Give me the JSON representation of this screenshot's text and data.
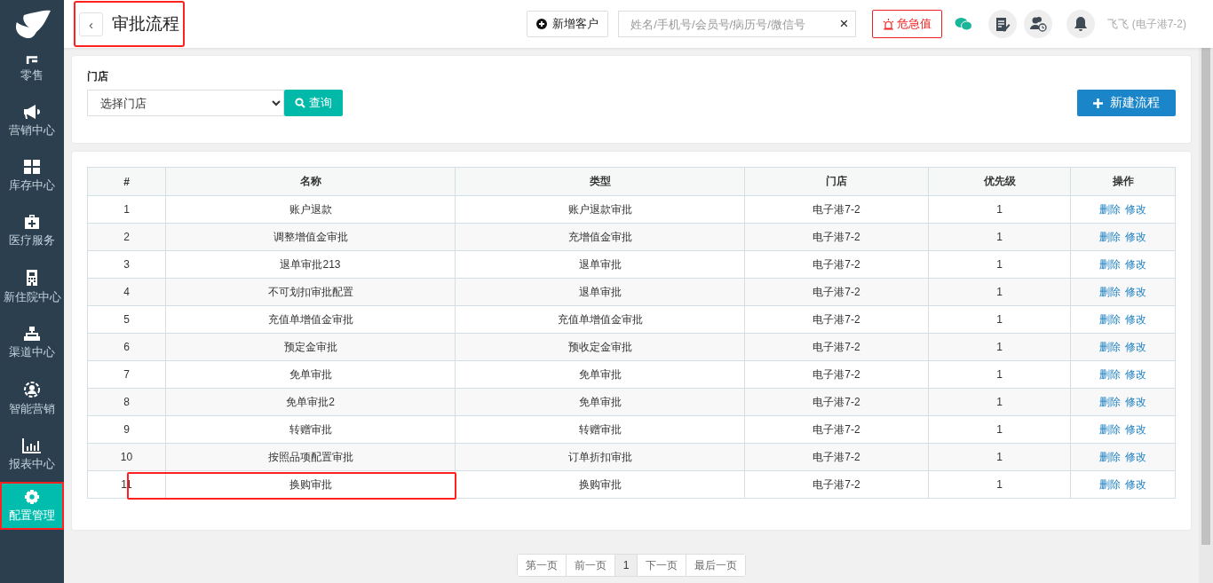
{
  "sidebar": {
    "items": [
      {
        "label": "零售",
        "selected": false,
        "highlighted": false
      },
      {
        "label": "营销中心",
        "selected": false,
        "highlighted": false
      },
      {
        "label": "库存中心",
        "selected": false,
        "highlighted": false
      },
      {
        "label": "医疗服务",
        "selected": false,
        "highlighted": false
      },
      {
        "label": "新住院中心",
        "selected": false,
        "highlighted": false
      },
      {
        "label": "渠道中心",
        "selected": false,
        "highlighted": false
      },
      {
        "label": "智能营销",
        "selected": false,
        "highlighted": false
      },
      {
        "label": "报表中心",
        "selected": false,
        "highlighted": false
      },
      {
        "label": "配置管理",
        "selected": true,
        "highlighted": true
      }
    ]
  },
  "header": {
    "back": "‹",
    "title": "审批流程",
    "highlighted": true,
    "add_customer": "新增客户",
    "search": {
      "placeholder": "姓名/手机号/会员号/病历号/微信号"
    },
    "clear": "×",
    "alert": "危急值",
    "user": "飞飞 (电子港7-2)"
  },
  "filter": {
    "label": "门店",
    "store_select": "选择门店",
    "query": "查询",
    "new_flow": "新建流程"
  },
  "table": {
    "columns": [
      "#",
      "名称",
      "类型",
      "门店",
      "优先级",
      "操作"
    ],
    "rows": [
      {
        "cells": [
          "1",
          "账户退款",
          "账户退款审批",
          "电子港7-2",
          "1"
        ],
        "actions": [
          "删除",
          "修改"
        ],
        "highlighted": false
      },
      {
        "cells": [
          "2",
          "调整增值金审批",
          "充增值金审批",
          "电子港7-2",
          "1"
        ],
        "actions": [
          "删除",
          "修改"
        ],
        "highlighted": false
      },
      {
        "cells": [
          "3",
          "退单审批213",
          "退单审批",
          "电子港7-2",
          "1"
        ],
        "actions": [
          "删除",
          "修改"
        ],
        "highlighted": false
      },
      {
        "cells": [
          "4",
          "不可划扣审批配置",
          "退单审批",
          "电子港7-2",
          "1"
        ],
        "actions": [
          "删除",
          "修改"
        ],
        "highlighted": false
      },
      {
        "cells": [
          "5",
          "充值单增值金审批",
          "充值单增值金审批",
          "电子港7-2",
          "1"
        ],
        "actions": [
          "删除",
          "修改"
        ],
        "highlighted": false
      },
      {
        "cells": [
          "6",
          "预定金审批",
          "预收定金审批",
          "电子港7-2",
          "1"
        ],
        "actions": [
          "删除",
          "修改"
        ],
        "highlighted": false
      },
      {
        "cells": [
          "7",
          "免单审批",
          "免单审批",
          "电子港7-2",
          "1"
        ],
        "actions": [
          "删除",
          "修改"
        ],
        "highlighted": false
      },
      {
        "cells": [
          "8",
          "免单审批2",
          "免单审批",
          "电子港7-2",
          "1"
        ],
        "actions": [
          "删除",
          "修改"
        ],
        "highlighted": false
      },
      {
        "cells": [
          "9",
          "转赠审批",
          "转赠审批",
          "电子港7-2",
          "1"
        ],
        "actions": [
          "删除",
          "修改"
        ],
        "highlighted": false
      },
      {
        "cells": [
          "10",
          "按照品项配置审批",
          "订单折扣审批",
          "电子港7-2",
          "1"
        ],
        "actions": [
          "删除",
          "修改"
        ],
        "highlighted": false
      },
      {
        "cells": [
          "11",
          "换购审批",
          "换购审批",
          "电子港7-2",
          "1"
        ],
        "actions": [
          "删除",
          "修改"
        ],
        "highlighted": true
      }
    ]
  },
  "pagination": [
    {
      "label": "第一页",
      "selected": false
    },
    {
      "label": "前一页",
      "selected": false
    },
    {
      "label": "1",
      "selected": true
    },
    {
      "label": "下一页",
      "selected": false
    },
    {
      "label": "最后一页",
      "selected": false
    }
  ]
}
